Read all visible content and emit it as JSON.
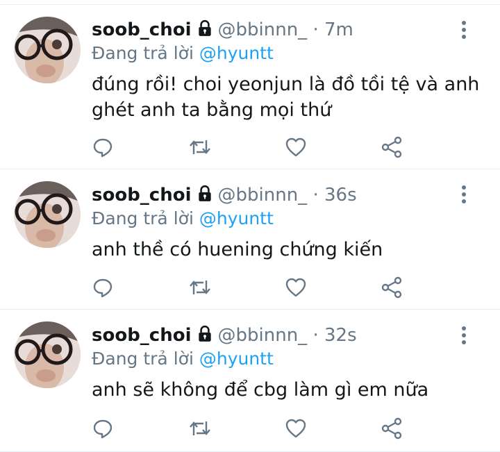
{
  "tweets": [
    {
      "display_name": "soob_choi",
      "handle": "@bbinnn_",
      "dot": "·",
      "time": "7m",
      "reply_prefix": "Đang trả lời ",
      "reply_mention": "@hyuntt",
      "text": "đúng rồi! choi yeonjun là đồ tồi tệ và anh ghét anh ta bằng mọi thứ"
    },
    {
      "display_name": "soob_choi",
      "handle": "@bbinnn_",
      "dot": "·",
      "time": "36s",
      "reply_prefix": "Đang trả lời ",
      "reply_mention": "@hyuntt",
      "text": "anh thề có huening chứng kiến"
    },
    {
      "display_name": "soob_choi",
      "handle": "@bbinnn_",
      "dot": "·",
      "time": "32s",
      "reply_prefix": "Đang trả lời ",
      "reply_mention": "@hyuntt",
      "text": "anh sẽ không để cbg làm gì em nữa"
    }
  ],
  "icons": {
    "header": [
      "lock-icon",
      "more-vertical-icon"
    ],
    "actions": [
      "reply-icon",
      "retweet-icon",
      "like-icon",
      "share-icon"
    ]
  },
  "colors": {
    "text": "#14171a",
    "secondary": "#657786",
    "mention": "#1da1f2",
    "divider": "#e6ecf0",
    "icon": "#657786"
  }
}
